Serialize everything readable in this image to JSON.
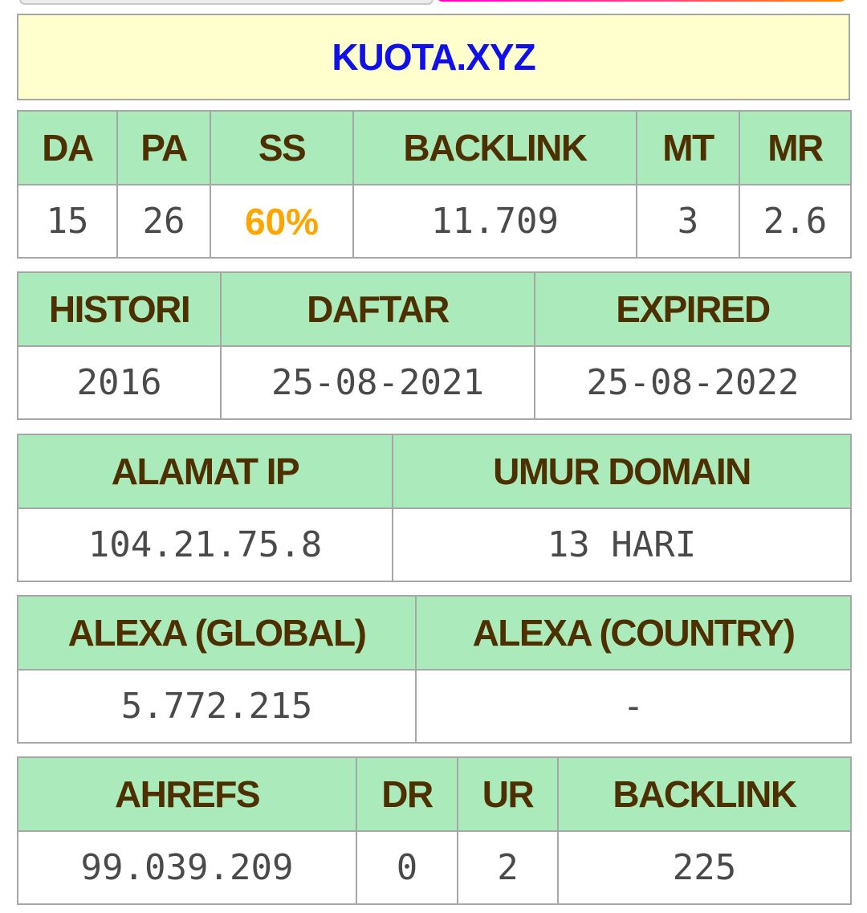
{
  "domain": "KUOTA.XYZ",
  "colors": {
    "title_bg": "#ffffcd",
    "title_text": "#1010ee",
    "header_bg": "#abeaba",
    "header_text": "#4d2f00",
    "value_text": "#4a4a4a",
    "highlight": "#ffa500",
    "border": "#a6a6a6"
  },
  "metrics": {
    "headers": [
      "DA",
      "PA",
      "SS",
      "BACKLINK",
      "MT",
      "MR"
    ],
    "values": [
      "15",
      "26",
      "60%",
      "11.709",
      "3",
      "2.6"
    ]
  },
  "history": {
    "headers": [
      "HISTORI",
      "DAFTAR",
      "EXPIRED"
    ],
    "values": [
      "2016",
      "25-08-2021",
      "25-08-2022"
    ]
  },
  "network": {
    "headers": [
      "ALAMAT IP",
      "UMUR DOMAIN"
    ],
    "values": [
      "104.21.75.8",
      "13 HARI"
    ]
  },
  "alexa": {
    "headers": [
      "ALEXA (GLOBAL)",
      "ALEXA (COUNTRY)"
    ],
    "values": [
      "5.772.215",
      "-"
    ]
  },
  "ahrefs": {
    "headers": [
      "AHREFS",
      "DR",
      "UR",
      "BACKLINK"
    ],
    "values": [
      "99.039.209",
      "0",
      "2",
      "225"
    ]
  }
}
